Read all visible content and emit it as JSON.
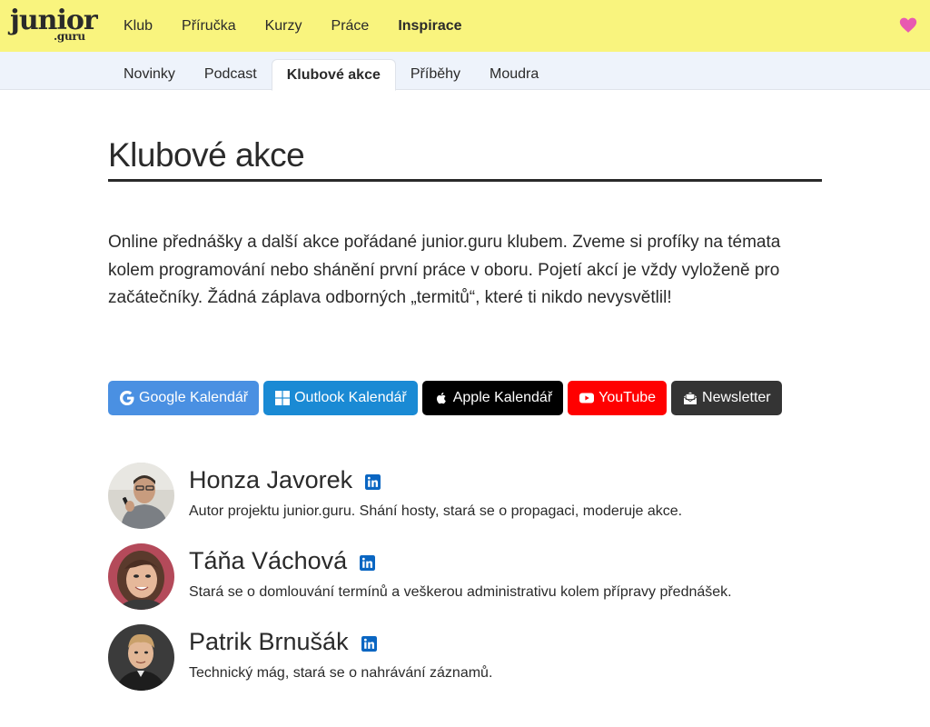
{
  "logo": {
    "line1": "junior",
    "line2": ".guru"
  },
  "nav": {
    "items": [
      {
        "label": "Klub",
        "active": false
      },
      {
        "label": "Příručka",
        "active": false
      },
      {
        "label": "Kurzy",
        "active": false
      },
      {
        "label": "Práce",
        "active": false
      },
      {
        "label": "Inspirace",
        "active": true
      }
    ],
    "heart_icon": "heart-icon",
    "heart_color": "#e85ab0"
  },
  "subnav": {
    "items": [
      {
        "label": "Novinky",
        "active": false
      },
      {
        "label": "Podcast",
        "active": false
      },
      {
        "label": "Klubové akce",
        "active": true
      },
      {
        "label": "Příběhy",
        "active": false
      },
      {
        "label": "Moudra",
        "active": false
      }
    ]
  },
  "page": {
    "title": "Klubové akce",
    "intro": "Online přednášky a další akce pořádané junior.guru klubem. Zveme si profíky na témata kolem programování nebo shánění první práce v oboru. Pojetí akcí je vždy vyloženě pro začátečníky. Žádná záplava odborných „termitů“, které ti nikdo nevysvětlil!"
  },
  "buttons": [
    {
      "label": "Google Kalendář",
      "icon": "google-icon",
      "color": "#4a90e2"
    },
    {
      "label": "Outlook Kalendář",
      "icon": "windows-icon",
      "color": "#1a8ad4"
    },
    {
      "label": "Apple Kalendář",
      "icon": "apple-icon",
      "color": "#000000"
    },
    {
      "label": "YouTube",
      "icon": "youtube-icon",
      "color": "#ff0000"
    },
    {
      "label": "Newsletter",
      "icon": "envelope-icon",
      "color": "#343434"
    }
  ],
  "people": [
    {
      "name": "Honza Javorek",
      "desc": "Autor projektu junior.guru. Shání hosty, stará se o propagaci, moderuje akce.",
      "icon": "linkedin-icon"
    },
    {
      "name": "Táňa Váchová",
      "desc": "Stará se o domlouvání termínů a veškerou administrativu kolem přípravy přednášek.",
      "icon": "linkedin-icon"
    },
    {
      "name": "Patrik Brnušák",
      "desc": "Technický mág, stará se o nahrávání záznamů.",
      "icon": "linkedin-icon"
    }
  ],
  "colors": {
    "topbar": "#f9f47e",
    "subbar": "#eef3fb",
    "linkedin": "#0a66c2"
  }
}
